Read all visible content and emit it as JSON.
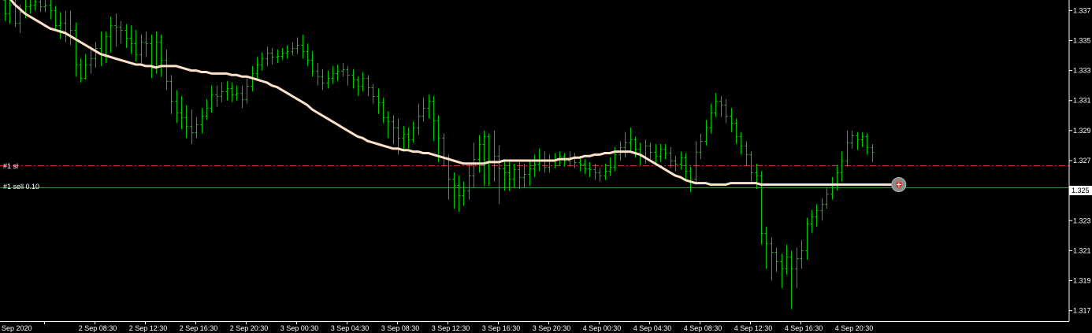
{
  "colors": {
    "background": "#000000",
    "candles": "#00c800",
    "moving_average": "#ffe0c8",
    "stop_loss_line": "#c83232",
    "order_line": "#3c8c3c",
    "axis": "#ffffff",
    "marker_ring": "#8a8a8a",
    "marker_core": "#ff2020"
  },
  "icons": {
    "trade_marker": "sell-marker-icon"
  },
  "levels": {
    "sl_label": "#1 sl",
    "order_label": "#1 sell 0.10"
  },
  "current_price_tag": "1.325",
  "chart_data": {
    "type": "line",
    "title": "",
    "xlabel": "",
    "ylabel": "",
    "ylim": [
      1.3163,
      1.3377
    ],
    "y_ticks": [
      "1.337",
      "1.335",
      "1.333",
      "1.331",
      "1.329",
      "1.327",
      "1.325",
      "1.323",
      "1.321",
      "1.319",
      "1.317"
    ],
    "x_ticks": [
      "Sep 2020",
      "2 Sep 08:30",
      "2 Sep 12:30",
      "2 Sep 16:30",
      "2 Sep 20:30",
      "3 Sep 00:30",
      "3 Sep 04:30",
      "3 Sep 08:30",
      "3 Sep 12:30",
      "3 Sep 16:30",
      "3 Sep 20:30",
      "4 Sep 00:30",
      "4 Sep 04:30",
      "4 Sep 08:30",
      "4 Sep 12:30",
      "4 Sep 16:30",
      "4 Sep 20:30"
    ],
    "levels": [
      {
        "name": "#1 sl",
        "value": 1.3267,
        "style": "dash-dot"
      },
      {
        "name": "#1 sell 0.10",
        "value": 1.3252,
        "style": "solid"
      }
    ],
    "ohlc": [
      [
        1.3377,
        1.3368,
        1.3377,
        1.3363
      ],
      [
        1.3368,
        1.3374,
        1.3378,
        1.3361
      ],
      [
        1.3374,
        1.3362,
        1.3379,
        1.3359
      ],
      [
        1.3362,
        1.3369,
        1.3374,
        1.3355
      ],
      [
        1.3369,
        1.3373,
        1.3378,
        1.3365
      ],
      [
        1.3373,
        1.3374,
        1.3377,
        1.3368
      ],
      [
        1.3374,
        1.3376,
        1.3379,
        1.337
      ],
      [
        1.3376,
        1.3373,
        1.3382,
        1.3369
      ],
      [
        1.3373,
        1.3374,
        1.338,
        1.3369
      ],
      [
        1.3374,
        1.337,
        1.3377,
        1.3364
      ],
      [
        1.337,
        1.336,
        1.3373,
        1.3357
      ],
      [
        1.336,
        1.3362,
        1.3369,
        1.3351
      ],
      [
        1.3362,
        1.3354,
        1.337,
        1.3349
      ],
      [
        1.3354,
        1.3357,
        1.337,
        1.3347
      ],
      [
        1.3357,
        1.3334,
        1.3362,
        1.3326
      ],
      [
        1.3334,
        1.3325,
        1.3338,
        1.3322
      ],
      [
        1.3325,
        1.3334,
        1.3341,
        1.3324
      ],
      [
        1.3334,
        1.3338,
        1.3346,
        1.3328
      ],
      [
        1.3338,
        1.3345,
        1.3349,
        1.3332
      ],
      [
        1.3345,
        1.3341,
        1.3356,
        1.3333
      ],
      [
        1.3341,
        1.3353,
        1.3356,
        1.3335
      ],
      [
        1.3353,
        1.336,
        1.3366,
        1.3342
      ],
      [
        1.336,
        1.3359,
        1.3368,
        1.3346
      ],
      [
        1.3359,
        1.3357,
        1.3363,
        1.3348
      ],
      [
        1.3357,
        1.3352,
        1.3361,
        1.3345
      ],
      [
        1.3352,
        1.3348,
        1.336,
        1.3341
      ],
      [
        1.3348,
        1.3341,
        1.3357,
        1.3336
      ],
      [
        1.3341,
        1.3349,
        1.3354,
        1.3333
      ],
      [
        1.3349,
        1.3348,
        1.3356,
        1.3339
      ],
      [
        1.3348,
        1.3332,
        1.3354,
        1.3325
      ],
      [
        1.3332,
        1.3349,
        1.3356,
        1.3328
      ],
      [
        1.3349,
        1.3337,
        1.3354,
        1.3326
      ],
      [
        1.3337,
        1.3323,
        1.3344,
        1.3317
      ],
      [
        1.3323,
        1.331,
        1.3327,
        1.3301
      ],
      [
        1.331,
        1.3302,
        1.3317,
        1.3295
      ],
      [
        1.3302,
        1.3299,
        1.3313,
        1.3291
      ],
      [
        1.3299,
        1.3293,
        1.3307,
        1.3285
      ],
      [
        1.3293,
        1.3289,
        1.3304,
        1.3281
      ],
      [
        1.3289,
        1.3294,
        1.3299,
        1.3285
      ],
      [
        1.3294,
        1.33,
        1.3305,
        1.3288
      ],
      [
        1.33,
        1.3305,
        1.3311,
        1.3297
      ],
      [
        1.3305,
        1.3314,
        1.332,
        1.3302
      ],
      [
        1.3314,
        1.3313,
        1.332,
        1.3306
      ],
      [
        1.3313,
        1.3316,
        1.3322,
        1.3309
      ],
      [
        1.3316,
        1.3318,
        1.3323,
        1.331
      ],
      [
        1.3318,
        1.3314,
        1.3322,
        1.3309
      ],
      [
        1.3314,
        1.3315,
        1.332,
        1.331
      ],
      [
        1.3315,
        1.3311,
        1.332,
        1.3305
      ],
      [
        1.3311,
        1.332,
        1.3325,
        1.3308
      ],
      [
        1.332,
        1.3328,
        1.3333,
        1.3316
      ],
      [
        1.3328,
        1.3334,
        1.3339,
        1.3324
      ],
      [
        1.3334,
        1.3338,
        1.3342,
        1.333
      ],
      [
        1.3338,
        1.3342,
        1.3346,
        1.3333
      ],
      [
        1.3342,
        1.3339,
        1.3345,
        1.3334
      ],
      [
        1.3339,
        1.334,
        1.3344,
        1.3335
      ],
      [
        1.334,
        1.3342,
        1.3345,
        1.3337
      ],
      [
        1.3342,
        1.3343,
        1.3347,
        1.3338
      ],
      [
        1.3343,
        1.3345,
        1.3349,
        1.334
      ],
      [
        1.3345,
        1.3347,
        1.3352,
        1.3341
      ],
      [
        1.3347,
        1.3343,
        1.3354,
        1.3338
      ],
      [
        1.3343,
        1.3337,
        1.3348,
        1.3333
      ],
      [
        1.3337,
        1.333,
        1.3343,
        1.3326
      ],
      [
        1.333,
        1.3326,
        1.3335,
        1.332
      ],
      [
        1.3326,
        1.3322,
        1.3331,
        1.3317
      ],
      [
        1.3322,
        1.3325,
        1.333,
        1.3318
      ],
      [
        1.3325,
        1.3328,
        1.3333,
        1.3321
      ],
      [
        1.3328,
        1.333,
        1.3334,
        1.3323
      ],
      [
        1.333,
        1.3331,
        1.3335,
        1.3326
      ],
      [
        1.3331,
        1.3327,
        1.3333,
        1.332
      ],
      [
        1.3327,
        1.3324,
        1.3331,
        1.3318
      ],
      [
        1.3324,
        1.332,
        1.3326,
        1.3313
      ],
      [
        1.332,
        1.3325,
        1.3329,
        1.3316
      ],
      [
        1.3325,
        1.3319,
        1.3327,
        1.3313
      ],
      [
        1.3319,
        1.3313,
        1.3321,
        1.3308
      ],
      [
        1.3313,
        1.3309,
        1.3318,
        1.3301
      ],
      [
        1.3309,
        1.3299,
        1.3312,
        1.3295
      ],
      [
        1.3299,
        1.3296,
        1.3303,
        1.3285
      ],
      [
        1.3296,
        1.3292,
        1.33,
        1.3281
      ],
      [
        1.3292,
        1.3285,
        1.3298,
        1.3274
      ],
      [
        1.3285,
        1.3288,
        1.3293,
        1.3276
      ],
      [
        1.3288,
        1.3284,
        1.3292,
        1.3278
      ],
      [
        1.3284,
        1.3292,
        1.3296,
        1.3282
      ],
      [
        1.3292,
        1.33,
        1.3308,
        1.3287
      ],
      [
        1.33,
        1.3305,
        1.3312,
        1.3296
      ],
      [
        1.3305,
        1.331,
        1.3314,
        1.3298
      ],
      [
        1.331,
        1.3297,
        1.3313,
        1.3283
      ],
      [
        1.3297,
        1.3285,
        1.33,
        1.3269
      ],
      [
        1.3285,
        1.3272,
        1.3288,
        1.3266
      ],
      [
        1.3272,
        1.3258,
        1.3274,
        1.3244
      ],
      [
        1.3258,
        1.3254,
        1.3262,
        1.3238
      ],
      [
        1.3254,
        1.3247,
        1.326,
        1.3236
      ],
      [
        1.3247,
        1.325,
        1.3256,
        1.324
      ],
      [
        1.325,
        1.326,
        1.3267,
        1.3244
      ],
      [
        1.326,
        1.3271,
        1.3282,
        1.3252
      ],
      [
        1.3271,
        1.3281,
        1.3287,
        1.3262
      ],
      [
        1.3281,
        1.3286,
        1.329,
        1.3253
      ],
      [
        1.3286,
        1.327,
        1.3288,
        1.3253
      ],
      [
        1.327,
        1.3273,
        1.329,
        1.3256
      ],
      [
        1.3273,
        1.3265,
        1.328,
        1.3241
      ],
      [
        1.3265,
        1.3262,
        1.3271,
        1.325
      ],
      [
        1.3262,
        1.3258,
        1.3269,
        1.325
      ],
      [
        1.3258,
        1.3264,
        1.3268,
        1.3252
      ],
      [
        1.3264,
        1.3259,
        1.3269,
        1.3251
      ],
      [
        1.3259,
        1.3261,
        1.3268,
        1.3252
      ],
      [
        1.3261,
        1.3265,
        1.327,
        1.3253
      ],
      [
        1.3265,
        1.3268,
        1.3274,
        1.3259
      ],
      [
        1.3268,
        1.327,
        1.3278,
        1.3263
      ],
      [
        1.327,
        1.3266,
        1.3276,
        1.3262
      ],
      [
        1.3266,
        1.327,
        1.3274,
        1.3262
      ],
      [
        1.327,
        1.3271,
        1.3275,
        1.3265
      ],
      [
        1.3271,
        1.3273,
        1.3276,
        1.3267
      ],
      [
        1.3273,
        1.327,
        1.3275,
        1.3266
      ],
      [
        1.327,
        1.3272,
        1.3276,
        1.3266
      ],
      [
        1.3272,
        1.3269,
        1.3275,
        1.3265
      ],
      [
        1.3269,
        1.3268,
        1.3273,
        1.3263
      ],
      [
        1.3268,
        1.3265,
        1.3271,
        1.3261
      ],
      [
        1.3265,
        1.3264,
        1.3269,
        1.3259
      ],
      [
        1.3264,
        1.3262,
        1.3268,
        1.3257
      ],
      [
        1.3262,
        1.326,
        1.3265,
        1.3256
      ],
      [
        1.326,
        1.3263,
        1.3268,
        1.3257
      ],
      [
        1.3263,
        1.3266,
        1.3272,
        1.326
      ],
      [
        1.3266,
        1.3274,
        1.3279,
        1.3263
      ],
      [
        1.3274,
        1.3279,
        1.3283,
        1.327
      ],
      [
        1.3279,
        1.3282,
        1.3289,
        1.3272
      ],
      [
        1.3282,
        1.3284,
        1.3292,
        1.3276
      ],
      [
        1.3284,
        1.3278,
        1.3286,
        1.3272
      ],
      [
        1.3278,
        1.3273,
        1.3282,
        1.3267
      ],
      [
        1.3273,
        1.328,
        1.3284,
        1.3268
      ],
      [
        1.328,
        1.3276,
        1.3282,
        1.3271
      ],
      [
        1.3276,
        1.3273,
        1.3281,
        1.3268
      ],
      [
        1.3273,
        1.3278,
        1.3281,
        1.3269
      ],
      [
        1.3278,
        1.3275,
        1.3281,
        1.3271
      ],
      [
        1.3275,
        1.327,
        1.3279,
        1.3265
      ],
      [
        1.327,
        1.3268,
        1.3273,
        1.3263
      ],
      [
        1.3268,
        1.3272,
        1.3276,
        1.3264
      ],
      [
        1.3272,
        1.3263,
        1.3275,
        1.3257
      ],
      [
        1.3263,
        1.3258,
        1.3266,
        1.3249
      ],
      [
        1.3258,
        1.3276,
        1.3283,
        1.3254
      ],
      [
        1.3276,
        1.3283,
        1.3288,
        1.3271
      ],
      [
        1.3283,
        1.3292,
        1.3297,
        1.328
      ],
      [
        1.3292,
        1.3302,
        1.3308,
        1.3288
      ],
      [
        1.3302,
        1.331,
        1.3315,
        1.3299
      ],
      [
        1.331,
        1.3307,
        1.3313,
        1.3299
      ],
      [
        1.3307,
        1.33,
        1.3311,
        1.3295
      ],
      [
        1.33,
        1.3295,
        1.3305,
        1.3289
      ],
      [
        1.3295,
        1.3286,
        1.3298,
        1.3281
      ],
      [
        1.3286,
        1.328,
        1.3289,
        1.3274
      ],
      [
        1.328,
        1.3274,
        1.3283,
        1.3267
      ],
      [
        1.3274,
        1.3262,
        1.3276,
        1.3256
      ],
      [
        1.3262,
        1.326,
        1.3268,
        1.3251
      ],
      [
        1.326,
        1.3222,
        1.3263,
        1.3214
      ],
      [
        1.3222,
        1.3215,
        1.3226,
        1.3198
      ],
      [
        1.3215,
        1.3209,
        1.3219,
        1.319
      ],
      [
        1.3209,
        1.3203,
        1.3212,
        1.3196
      ],
      [
        1.3203,
        1.3198,
        1.3208,
        1.3185
      ],
      [
        1.3198,
        1.3206,
        1.3214,
        1.3194
      ],
      [
        1.3206,
        1.3198,
        1.321,
        1.3171
      ],
      [
        1.3198,
        1.3205,
        1.3212,
        1.3185
      ],
      [
        1.3205,
        1.321,
        1.3217,
        1.3198
      ],
      [
        1.321,
        1.3228,
        1.3232,
        1.3204
      ],
      [
        1.3228,
        1.3233,
        1.3237,
        1.3222
      ],
      [
        1.3233,
        1.3237,
        1.3241,
        1.3226
      ],
      [
        1.3237,
        1.3241,
        1.3245,
        1.323
      ],
      [
        1.3241,
        1.3248,
        1.3252,
        1.3238
      ],
      [
        1.3248,
        1.3255,
        1.3259,
        1.3244
      ],
      [
        1.3255,
        1.3262,
        1.3267,
        1.325
      ],
      [
        1.3262,
        1.327,
        1.3276,
        1.3256
      ],
      [
        1.327,
        1.3282,
        1.329,
        1.3266
      ],
      [
        1.3282,
        1.3287,
        1.329,
        1.3278
      ],
      [
        1.3287,
        1.3284,
        1.3289,
        1.3277
      ],
      [
        1.3284,
        1.3286,
        1.3289,
        1.3279
      ],
      [
        1.3286,
        1.3279,
        1.3288,
        1.3274
      ],
      [
        1.3279,
        1.3276,
        1.3281,
        1.3269
      ]
    ],
    "ma": [
      1.3382,
      1.3378,
      1.3374,
      1.3371,
      1.3368,
      1.3366,
      1.3364,
      1.3362,
      1.336,
      1.3358,
      1.3357,
      1.3356,
      1.3355,
      1.3353,
      1.3351,
      1.3349,
      1.3347,
      1.3345,
      1.3343,
      1.3341,
      1.334,
      1.3339,
      1.3338,
      1.3337,
      1.3336,
      1.3335,
      1.3334,
      1.3334,
      1.3333,
      1.3333,
      1.3332,
      1.3333,
      1.3333,
      1.3333,
      1.3333,
      1.3332,
      1.3331,
      1.333,
      1.333,
      1.3329,
      1.3329,
      1.3328,
      1.3328,
      1.3328,
      1.3328,
      1.3327,
      1.3327,
      1.3326,
      1.3326,
      1.3325,
      1.3324,
      1.3323,
      1.3322,
      1.332,
      1.3319,
      1.3317,
      1.3315,
      1.3313,
      1.3311,
      1.3309,
      1.3307,
      1.3304,
      1.3302,
      1.33,
      1.3298,
      1.3296,
      1.3294,
      1.3292,
      1.329,
      1.3288,
      1.3286,
      1.3285,
      1.3283,
      1.3282,
      1.3281,
      1.328,
      1.3279,
      1.3278,
      1.3278,
      1.3277,
      1.3277,
      1.3276,
      1.3276,
      1.3275,
      1.3275,
      1.3274,
      1.3273,
      1.3272,
      1.3271,
      1.327,
      1.3269,
      1.3268,
      1.3268,
      1.3268,
      1.3268,
      1.3268,
      1.3269,
      1.3269,
      1.3269,
      1.327,
      1.327,
      1.327,
      1.327,
      1.327,
      1.327,
      1.327,
      1.327,
      1.327,
      1.327,
      1.327,
      1.3271,
      1.3271,
      1.3271,
      1.3272,
      1.3272,
      1.3273,
      1.3273,
      1.3274,
      1.3274,
      1.3275,
      1.3275,
      1.3276,
      1.3276,
      1.3276,
      1.3276,
      1.3275,
      1.3274,
      1.3272,
      1.327,
      1.3268,
      1.3266,
      1.3264,
      1.3262,
      1.326,
      1.3259,
      1.3257,
      1.3256,
      1.3255,
      1.3255,
      1.3255,
      1.3254,
      1.3254,
      1.3254,
      1.3254,
      1.3255,
      1.3255,
      1.3255,
      1.3255,
      1.3255,
      1.3255,
      1.3254,
      1.3254,
      1.3254,
      1.3254,
      1.3254,
      1.3254,
      1.3254,
      1.3254,
      1.3254,
      1.3254,
      1.3254,
      1.3254,
      1.3254,
      1.3254,
      1.3254,
      1.3254,
      1.3254,
      1.3254,
      1.3254,
      1.3254,
      1.3254,
      1.3254,
      1.3254,
      1.3254,
      1.3254,
      1.3254,
      1.3254,
      1.3254
    ]
  }
}
